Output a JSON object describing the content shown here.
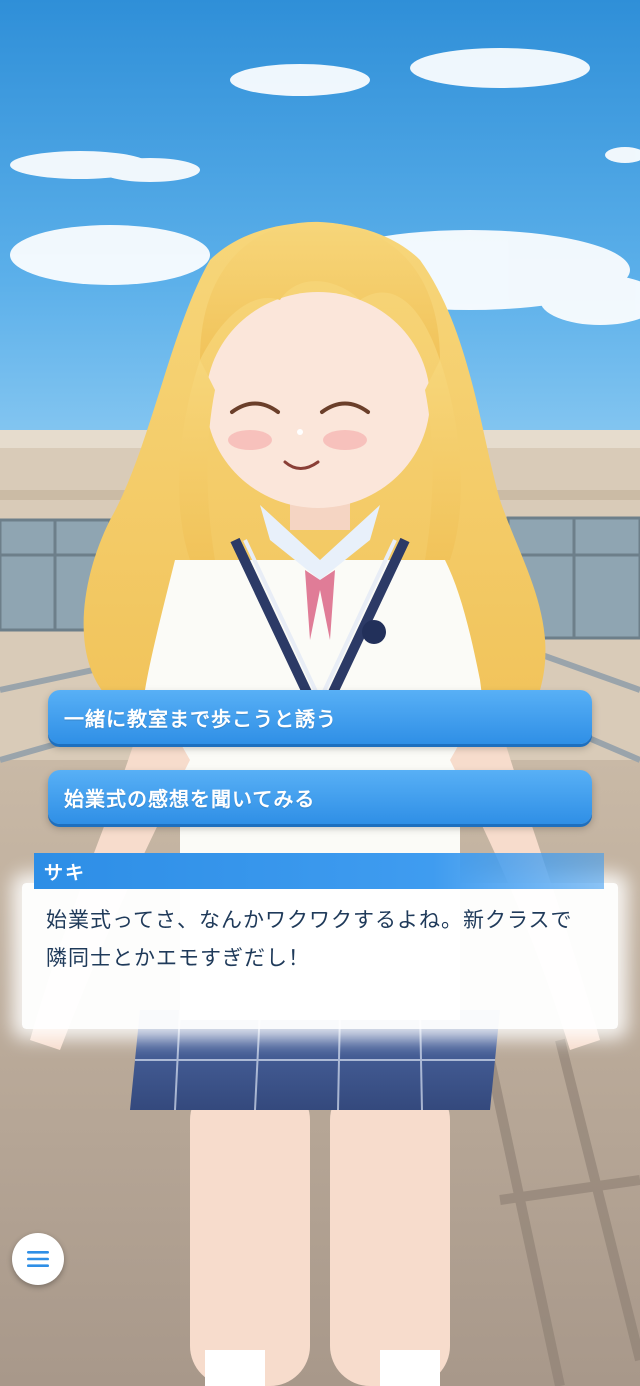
{
  "scene": {
    "character_name": "サキ",
    "sky_color": "#4aa3e3",
    "accent_color": "#2f8fe6"
  },
  "choices": [
    {
      "label": "一緒に教室まで歩こうと誘う"
    },
    {
      "label": "始業式の感想を聞いてみる"
    }
  ],
  "dialog": {
    "speaker": "サキ",
    "text": "始業式ってさ、なんかワクワクするよね。新クラスで隣同士とかエモすぎだし！"
  },
  "menu": {
    "icon": "hamburger-menu-icon"
  }
}
